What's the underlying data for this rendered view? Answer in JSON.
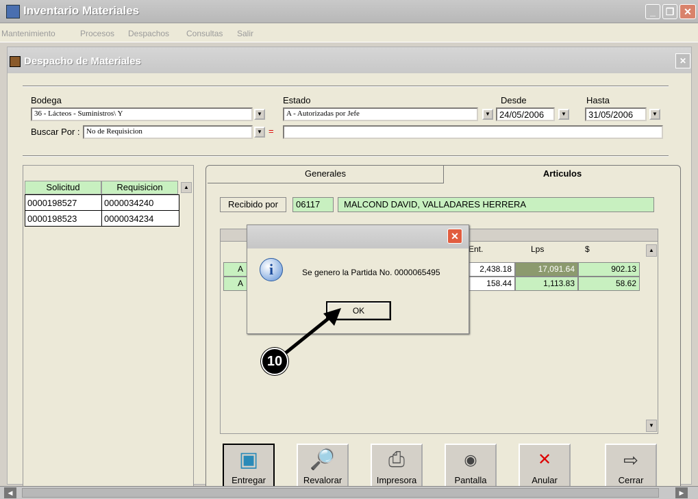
{
  "app": {
    "title": "Inventario Materiales"
  },
  "menu": [
    "Mantenimiento",
    "Procesos",
    "Despachos",
    "Consultas",
    "Salir"
  ],
  "child": {
    "title": "Despacho de Materiales"
  },
  "filters": {
    "bodega_label": "Bodega",
    "bodega_value": "36 - Lácteos - Suministros\\ Y",
    "estado_label": "Estado",
    "estado_value": "A - Autorizadas por Jefe",
    "desde_label": "Desde",
    "desde_value": "24/05/2006",
    "hasta_label": "Hasta",
    "hasta_value": "31/05/2006",
    "buscar_label": "Buscar Por :",
    "buscar_value": "No de Requisicion",
    "eq": "="
  },
  "left_grid": {
    "headers": [
      "Solicitud",
      "Requisicion"
    ],
    "rows": [
      [
        "0000198527",
        "0000034240"
      ],
      [
        "0000198523",
        "0000034234"
      ]
    ]
  },
  "tabs": [
    "Generales",
    "Articulos"
  ],
  "recibido": {
    "label": "Recibido por",
    "code": "06117",
    "name": "MALCOND DAVID, VALLADARES HERRERA"
  },
  "items": {
    "headers": [
      "Ent.",
      "Lps",
      "$"
    ],
    "rows": [
      {
        "a": "A",
        "ent": "2,438.18",
        "lps": "17,091.64",
        "usd": "902.13"
      },
      {
        "a": "A",
        "ent": "158.44",
        "lps": "1,113.83",
        "usd": "58.62"
      }
    ]
  },
  "dialog": {
    "message": "Se genero la Partida No. 0000065495",
    "ok": "OK",
    "icon": "info-icon"
  },
  "callout": "10",
  "toolbar": [
    "Entregar",
    "Revalorar",
    "Impresora",
    "Pantalla",
    "Anular",
    "Cerrar"
  ]
}
